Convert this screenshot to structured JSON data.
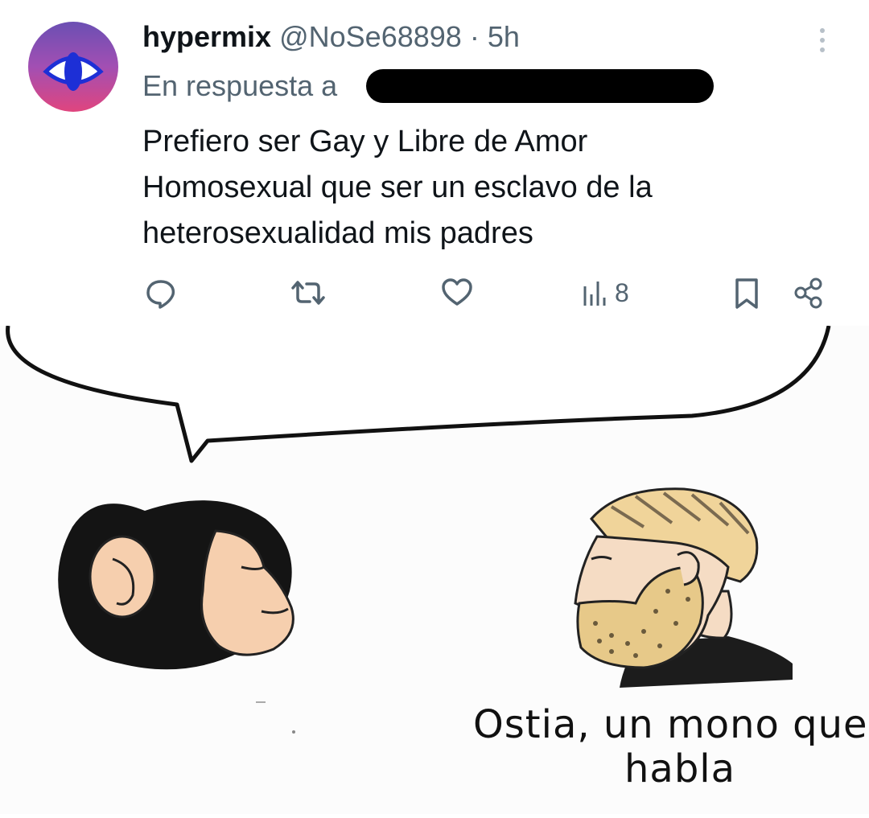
{
  "tweet": {
    "username": "hypermix",
    "handle": "@NoSe68898",
    "separator": "·",
    "time": "5h",
    "reply_prefix": "En respuesta a",
    "text_lines": [
      "Prefiero ser Gay y Libre de Amor",
      "Homosexual que ser un esclavo de la",
      "heterosexualidad mis padres"
    ],
    "actions": {
      "reply_icon": "comment-icon",
      "retweet_icon": "retweet-icon",
      "like_icon": "heart-icon",
      "views_icon": "views-chart-icon",
      "views_count": "8",
      "bookmark_icon": "bookmark-icon",
      "share_icon": "share-icon"
    },
    "colors": {
      "text": "#0f1419",
      "muted": "#536471",
      "avatar_gradient": [
        "#6b4fb3",
        "#e0457e"
      ]
    }
  },
  "meme": {
    "caption_line1": "Ostia, un mono que",
    "caption_line2": "habla"
  }
}
